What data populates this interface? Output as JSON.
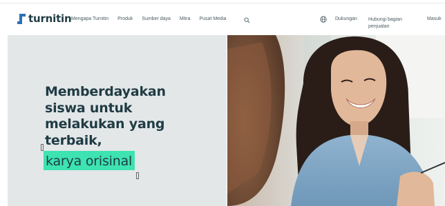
{
  "header": {
    "logo_text": "turnitin",
    "nav": [
      {
        "label": "Mengapa Turnitin"
      },
      {
        "label": "Produk"
      },
      {
        "label": "Sumber daya"
      },
      {
        "label": "Mitra"
      },
      {
        "label": "Pusat Media"
      }
    ],
    "support_label": "Dukungan",
    "contact_label": "Hubungi bagian penjualan",
    "login_label": "Masuk"
  },
  "hero": {
    "title": "Memberdayakan siswa untuk melakukan yang terbaik,",
    "highlight": "karya orisinal"
  },
  "colors": {
    "accent": "#3de3b0",
    "brand_blue": "#2c6fb7",
    "text_dark": "#1f3b44",
    "hero_bg": "#e3e7e8"
  },
  "icons": [
    "search-icon",
    "globe-icon"
  ]
}
